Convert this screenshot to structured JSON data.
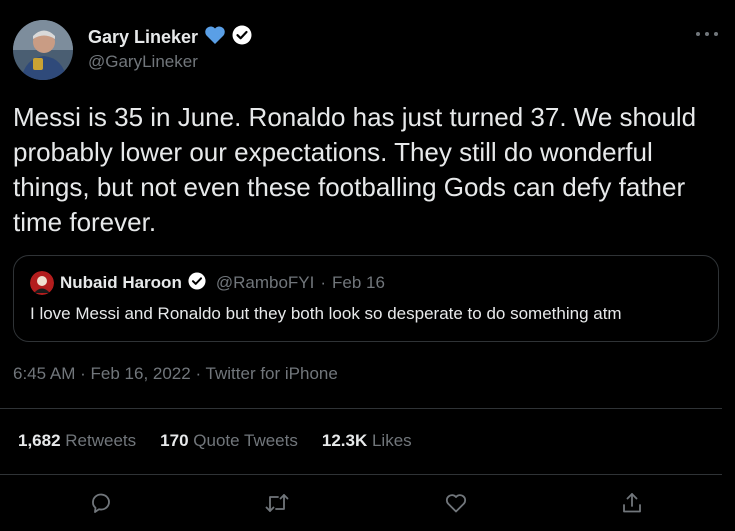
{
  "author": {
    "name": "Gary Lineker",
    "handle": "@GaryLineker",
    "heart_emoji": "💙"
  },
  "tweet_text": "Messi is 35 in June. Ronaldo has just turned 37. We should probably lower our expectations. They still do wonderful things, but not even these footballing Gods can defy father time forever.",
  "quoted": {
    "name": "Nubaid Haroon",
    "handle": "@RamboFYI",
    "separator": "·",
    "date": "Feb 16",
    "text": "I love Messi and Ronaldo but they both look so desperate to do something atm"
  },
  "meta": {
    "time": "6:45 AM",
    "sep1": "·",
    "date": "Feb 16, 2022",
    "sep2": "·",
    "source": "Twitter for iPhone"
  },
  "stats": {
    "retweets_count": "1,682",
    "retweets_label": "Retweets",
    "quotes_count": "170",
    "quotes_label": "Quote Tweets",
    "likes_count": "12.3K",
    "likes_label": "Likes"
  },
  "colors": {
    "background": "#000000",
    "text": "#e7e9ea",
    "secondary": "#71767b",
    "border": "#2f3336",
    "verified": "#ffffff"
  },
  "icons": [
    "more-icon",
    "verified-icon",
    "reply-icon",
    "retweet-icon",
    "like-icon",
    "share-icon"
  ]
}
